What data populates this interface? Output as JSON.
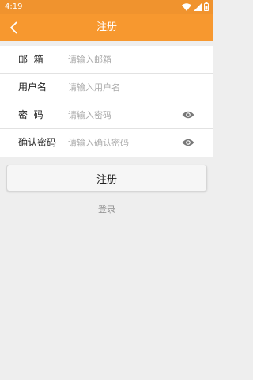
{
  "status_bar": {
    "time": "4:19",
    "icons": [
      "wifi-icon",
      "cell-signal-icon",
      "battery-icon"
    ]
  },
  "app_bar": {
    "back_icon": "back-arrow-icon",
    "title": "注册"
  },
  "form": {
    "email": {
      "label": "邮  箱",
      "value": "",
      "placeholder": "请输入邮箱"
    },
    "username": {
      "label": "用户名",
      "value": "",
      "placeholder": "请输入用户名"
    },
    "password": {
      "label": "密  码",
      "value": "",
      "placeholder": "请输入密码",
      "toggle_icon": "eye-icon"
    },
    "confirm_password": {
      "label": "确认密码",
      "value": "",
      "placeholder": "请输入确认密码",
      "toggle_icon": "eye-icon"
    }
  },
  "actions": {
    "register_label": "注册",
    "login_label": "登录"
  },
  "colors": {
    "accent": "#f7982f",
    "background": "#eeeeee",
    "placeholder": "#a9a9a9"
  }
}
